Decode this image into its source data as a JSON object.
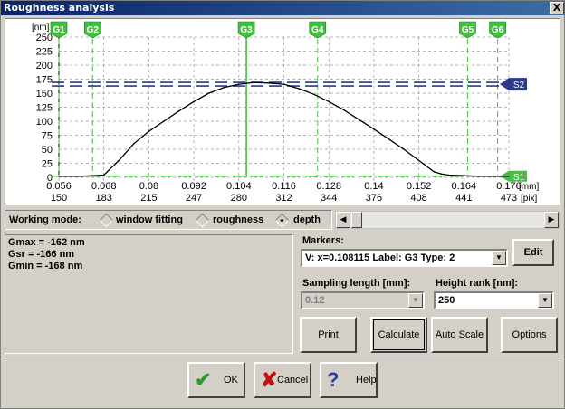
{
  "window": {
    "title": "Roughness analysis",
    "close_label": "X"
  },
  "chart": {
    "y_unit": "[nm]",
    "y_ticks": [
      "250",
      "225",
      "200",
      "175",
      "150",
      "125",
      "100",
      "75",
      "50",
      "25",
      "0"
    ],
    "x_top_ticks": [
      "0.056",
      "0.068",
      "0.08",
      "0.092",
      "0.104",
      "0.116",
      "0.128",
      "0.14",
      "0.152",
      "0.164",
      "0.176"
    ],
    "x_bottom_ticks": [
      "150",
      "183",
      "215",
      "247",
      "280",
      "312",
      "344",
      "376",
      "408",
      "441",
      "473"
    ],
    "x_top_unit": "[mm]",
    "x_bottom_unit": "[pix]",
    "markers": [
      "G1",
      "G2",
      "G3",
      "G4",
      "G5",
      "G6"
    ],
    "levels": [
      "S2",
      "S1"
    ],
    "colors": {
      "profile": "#000000",
      "markers": "#44c040",
      "s2": "#2a3a8c",
      "grid": "#9a9a9a"
    }
  },
  "chart_data": {
    "type": "line",
    "xlabel": "[mm]",
    "ylabel": "[nm]",
    "ylim": [
      0,
      250
    ],
    "xlim": [
      0.056,
      0.176
    ],
    "x": [
      0.056,
      0.062,
      0.068,
      0.072,
      0.076,
      0.08,
      0.084,
      0.088,
      0.092,
      0.096,
      0.1,
      0.104,
      0.108,
      0.112,
      0.116,
      0.12,
      0.124,
      0.128,
      0.132,
      0.136,
      0.14,
      0.144,
      0.148,
      0.152,
      0.156,
      0.158,
      0.16,
      0.164,
      0.168,
      0.172,
      0.176
    ],
    "y": [
      2,
      2,
      4,
      30,
      60,
      82,
      100,
      118,
      135,
      150,
      160,
      166,
      169,
      168,
      166,
      158,
      148,
      135,
      120,
      103,
      86,
      68,
      50,
      30,
      10,
      6,
      4,
      3,
      2,
      2,
      2
    ],
    "markers_x": {
      "G1": 0.056,
      "G2": 0.065,
      "G3": 0.106,
      "G4": 0.125,
      "G5": 0.165,
      "G6": 0.173
    },
    "levels_y": {
      "S2": 166,
      "S1": 2
    }
  },
  "mode": {
    "label": "Working mode:",
    "options": [
      "window fitting",
      "roughness",
      "depth"
    ],
    "selected": "depth"
  },
  "results": {
    "gmax": "Gmax = -162 nm",
    "gsr": "Gsr = -166 nm",
    "gmin": "Gmin = -168 nm"
  },
  "markers_panel": {
    "label": "Markers:",
    "value": "V: x=0.108115  Label: G3  Type: 2",
    "edit_label": "Edit"
  },
  "sampling": {
    "label": "Sampling length [mm]:",
    "value": "0.12"
  },
  "height_rank": {
    "label": "Height rank [nm]:",
    "value": "250"
  },
  "buttons": {
    "print": "Print",
    "calculate": "Calculate",
    "autoscale": "Auto Scale",
    "options": "Options",
    "ok": "OK",
    "cancel": "Cancel",
    "help": "Help"
  }
}
